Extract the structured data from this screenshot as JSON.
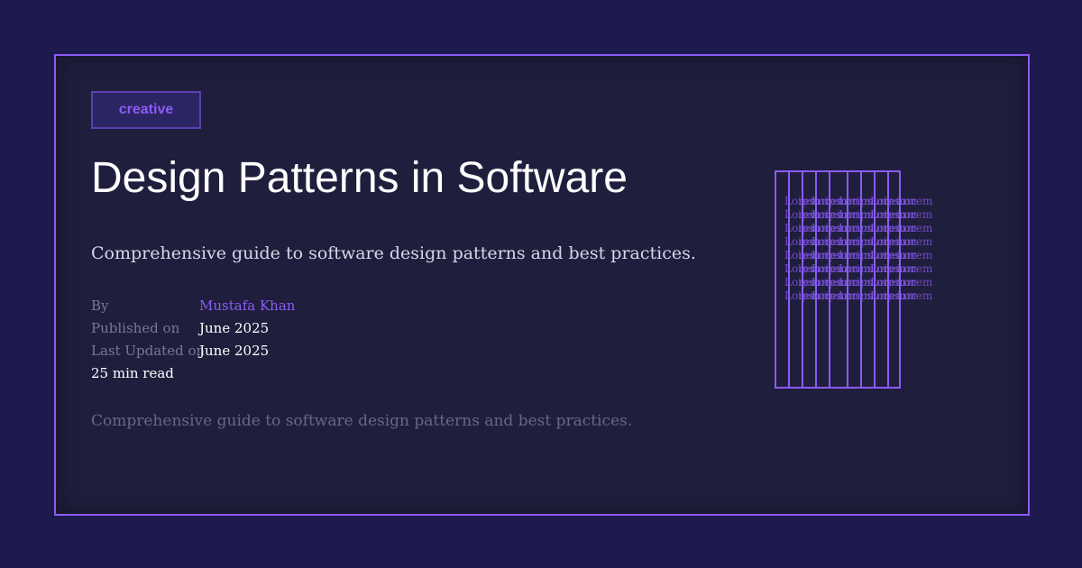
{
  "tag": "creative",
  "title": "Design Patterns in Software",
  "subtitle": "Comprehensive guide to software design patterns and best practices.",
  "meta": {
    "by_label": "By",
    "author": "Mustafa Khan",
    "published_label": "Published on",
    "published": "June 2025",
    "updated_label": "Last Updated on",
    "updated": "June 2025",
    "read_time": "25 min read"
  },
  "excerpt": "Comprehensive guide to software design patterns and best practices.",
  "art": {
    "words": [
      "Lorem",
      "ipsum",
      "Lorem",
      "ipsum",
      "Lorem",
      "ipsum",
      "Lorem",
      "ipsum",
      "Lorem"
    ],
    "rows": 8
  },
  "colors": {
    "background": "#1e1a4d",
    "card": "#1f1e3d",
    "accent": "#8b5cf6",
    "title": "#ffffff",
    "muted": "#7a7892"
  }
}
